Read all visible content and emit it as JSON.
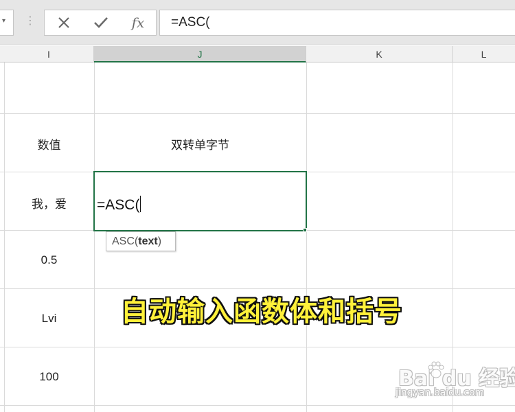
{
  "formula_bar": {
    "name_box_arrow": "▾",
    "grip": "⋮",
    "cancel_icon": "close-icon",
    "enter_icon": "check-icon",
    "fx_label": "fx",
    "formula_text": "=ASC("
  },
  "columns": [
    "I",
    "J",
    "K",
    "L"
  ],
  "cells": {
    "I6": "数值",
    "J6": "双转单字节",
    "I7": "我，爱",
    "I8": "0.5",
    "I9": "Lvi",
    "I10": "100"
  },
  "editing_cell": {
    "text": "=ASC("
  },
  "tooltip": {
    "func": "ASC(",
    "arg": "text",
    "close": ")"
  },
  "annotation": "自动输入函数体和括号",
  "watermark": {
    "logo_text": "Bai  du 经验",
    "url": "jingyan.baidu.com"
  },
  "colors": {
    "accent": "#217346",
    "annotation": "#fff13a"
  }
}
